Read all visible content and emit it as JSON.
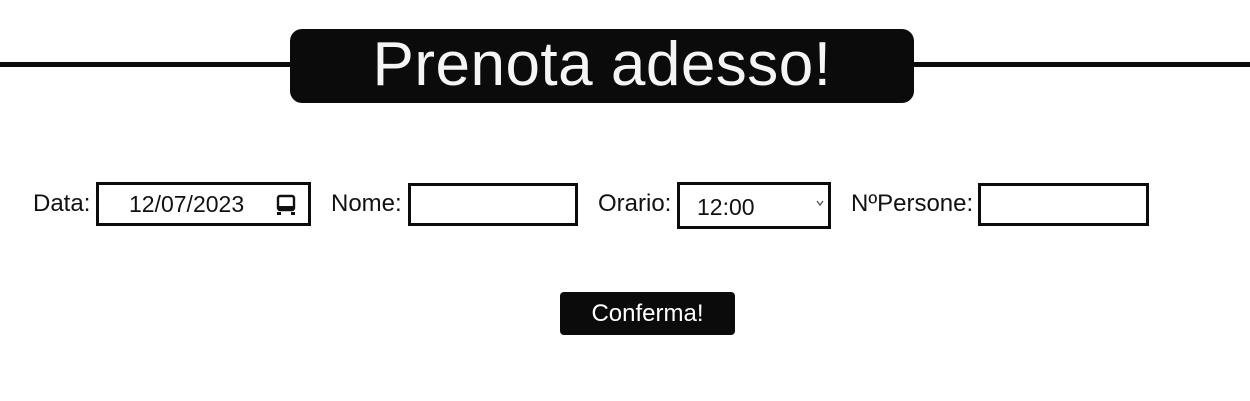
{
  "header": {
    "title": "Prenota adesso!"
  },
  "form": {
    "date": {
      "label": "Data:",
      "value": "12/07/2023"
    },
    "name": {
      "label": "Nome:",
      "value": ""
    },
    "time": {
      "label": "Orario:",
      "selected": "12:00"
    },
    "people": {
      "label": "NºPersone:",
      "value": ""
    },
    "submit_label": "Conferma!"
  },
  "icons": {
    "date_picker": "calendar-icon",
    "select_arrow": "chevron-down-icon"
  },
  "colors": {
    "accent": "#0b0b0b",
    "title_text": "#f5f5f5",
    "background": "#ffffff"
  }
}
